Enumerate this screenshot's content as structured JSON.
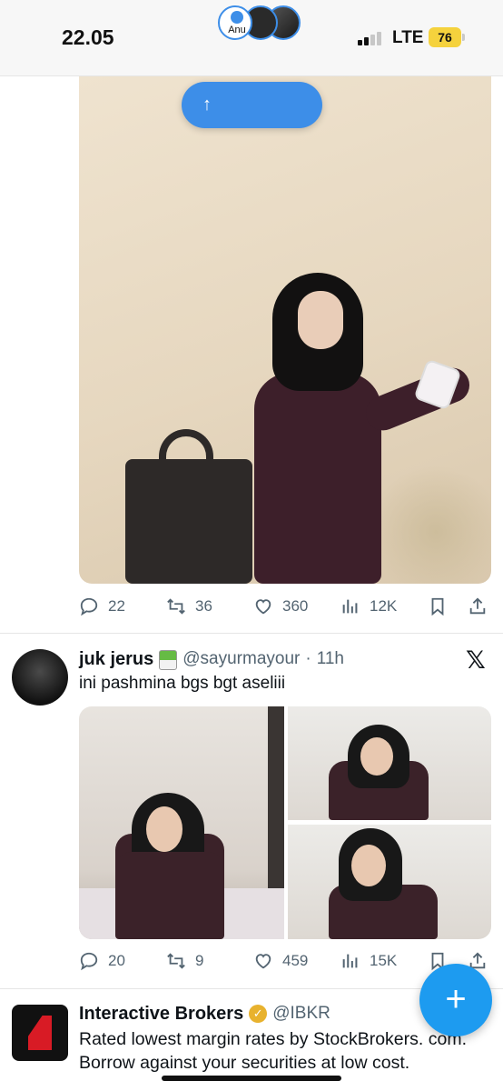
{
  "status_bar": {
    "time": "22.05",
    "network": "LTE",
    "battery": "76",
    "battery_color": "#f5d23d"
  },
  "pill": {
    "arrow": "↑",
    "avatar_label": "Anu"
  },
  "post1": {
    "stats": {
      "replies": "22",
      "reposts": "36",
      "likes": "360",
      "views": "12K"
    }
  },
  "post2": {
    "name": "juk jerus",
    "handle": "@sayurmayour",
    "separator": "·",
    "age": "11h",
    "text": "ini pashmina bgs bgt aseliii",
    "stats": {
      "replies": "20",
      "reposts": "9",
      "likes": "459",
      "views": "15K"
    },
    "x_logo": "𝕏"
  },
  "ad": {
    "name": "Interactive Brokers",
    "verified": "✓",
    "handle": "@IBKR",
    "text": "Rated lowest margin rates by StockBrokers. com. Borrow against your securities at low cost."
  },
  "fab": {
    "label": "+"
  },
  "colors": {
    "accent": "#1d9bf0",
    "muted": "#536471",
    "pill": "#3d8ee8"
  }
}
